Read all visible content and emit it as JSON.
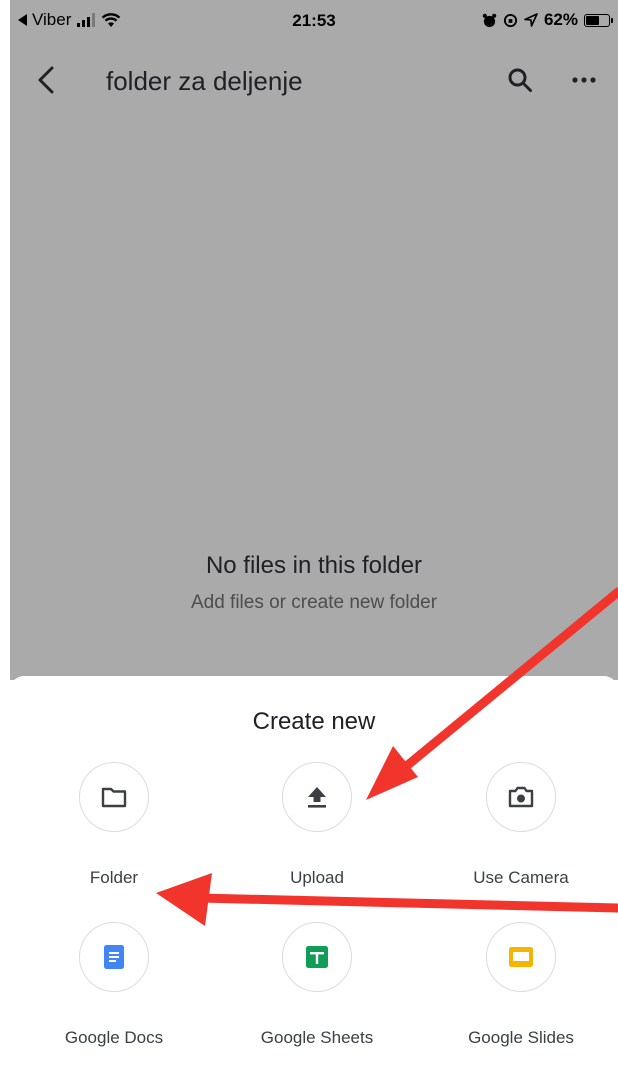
{
  "status_bar": {
    "back_app": "Viber",
    "time": "21:53",
    "battery": "62%",
    "battery_level": 0.62
  },
  "app_bar": {
    "title": "folder za deljenje",
    "back_icon": "chevron-left-icon",
    "search_icon": "search-icon",
    "more_icon": "more-horizontal-icon"
  },
  "empty_state": {
    "title": "No files in this folder",
    "subtitle": "Add files or create new folder"
  },
  "sheet": {
    "title": "Create new",
    "options": [
      {
        "label": "Folder",
        "icon": "folder-icon"
      },
      {
        "label": "Upload",
        "icon": "upload-icon"
      },
      {
        "label": "Use Camera",
        "icon": "camera-icon"
      },
      {
        "label": "Google Docs",
        "icon": "google-docs-icon"
      },
      {
        "label": "Google Sheets",
        "icon": "google-sheets-icon"
      },
      {
        "label": "Google Slides",
        "icon": "google-slides-icon"
      }
    ]
  },
  "colors": {
    "overlay": "#aaaaaa",
    "docs": "#4285f4",
    "sheets": "#0f9d58",
    "slides": "#f4b400",
    "annotation_arrow": "#f2352c"
  }
}
